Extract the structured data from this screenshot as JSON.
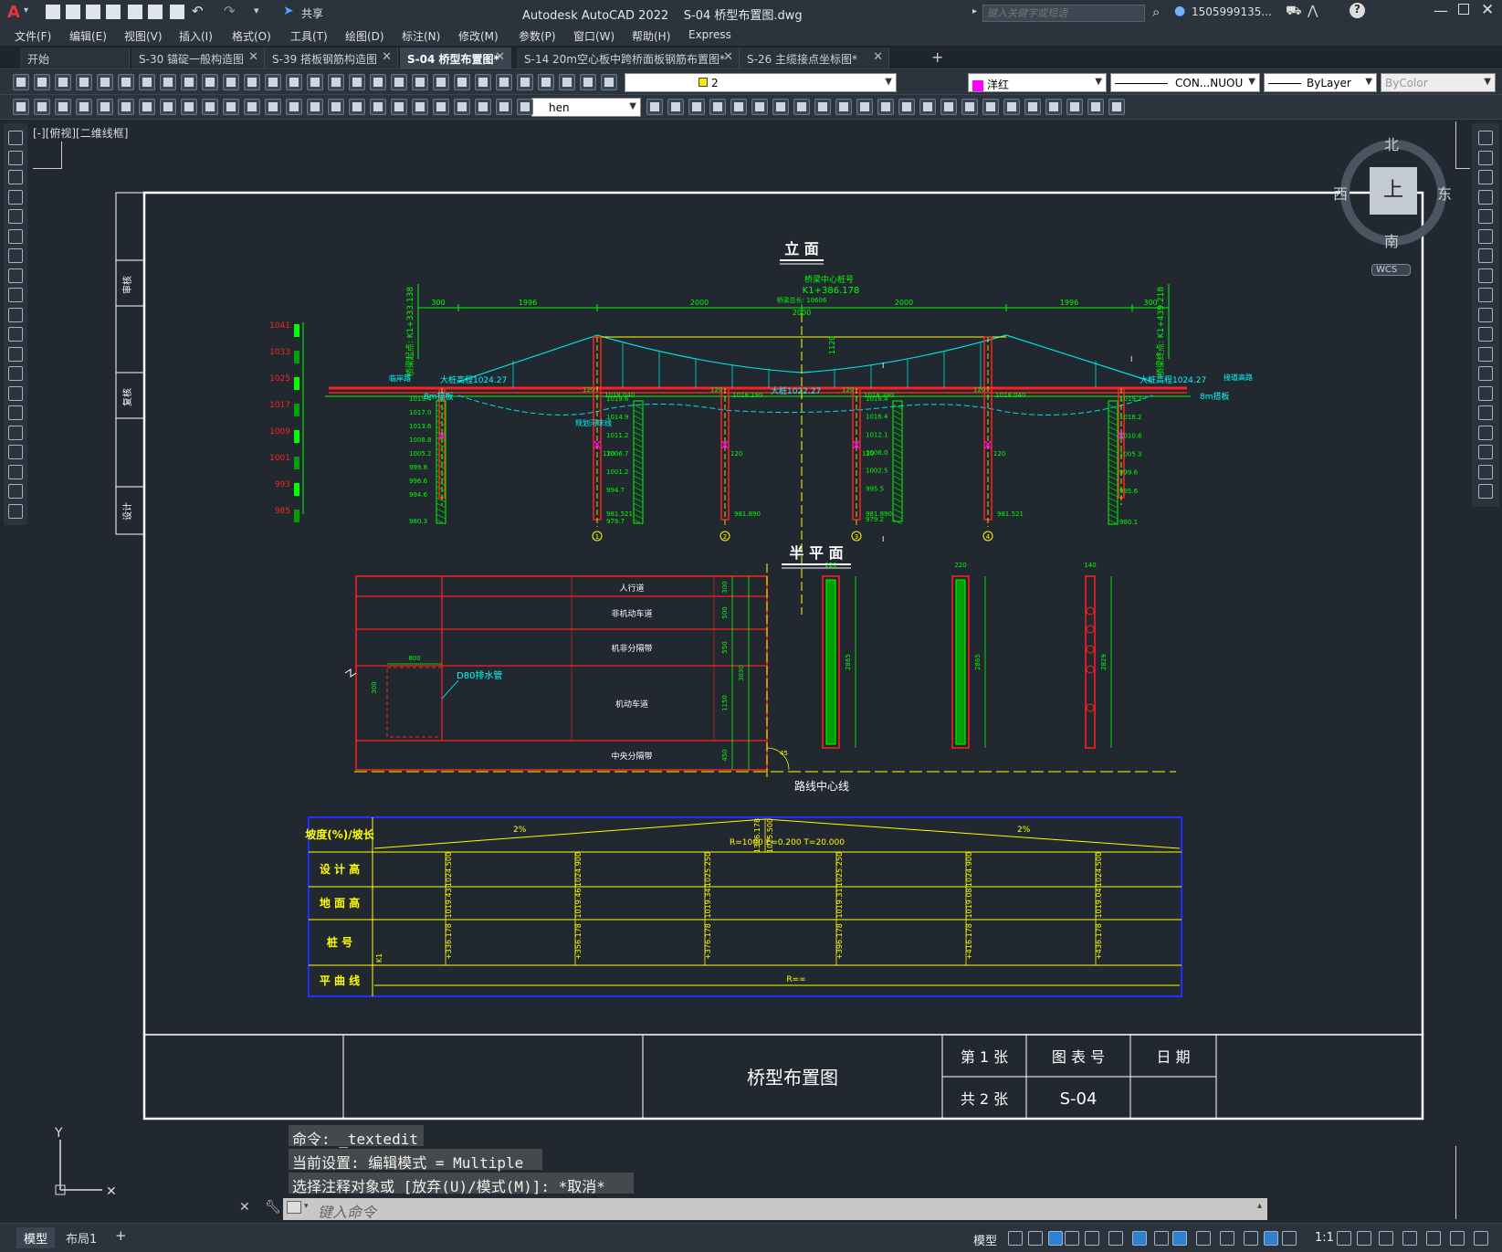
{
  "app": {
    "title": "Autodesk AutoCAD 2022    S-04 桥型布置图.dwg",
    "share_label": "共享",
    "search_placeholder": "键入关键字或短语",
    "user": "1505999135...",
    "logo_letter": "A"
  },
  "menu": [
    "文件(F)",
    "编辑(E)",
    "视图(V)",
    "插入(I)",
    "格式(O)",
    "工具(T)",
    "绘图(D)",
    "标注(N)",
    "修改(M)",
    "参数(P)",
    "窗口(W)",
    "帮助(H)",
    "Express"
  ],
  "tabs": [
    {
      "label": "开始",
      "active": false
    },
    {
      "label": "S-30 锚碇一般构造图",
      "active": false
    },
    {
      "label": "S-39 搭板钢筋构造图",
      "active": false
    },
    {
      "label": "S-04 桥型布置图*",
      "active": true
    },
    {
      "label": "S-14 20m空心板中跨桥面板钢筋布置图*",
      "active": false
    },
    {
      "label": "S-26 主缆接点坐标图*",
      "active": false
    }
  ],
  "toolbar": {
    "layer_value": "2",
    "color_value": "洋红",
    "linetype_value": "CON...NUOU",
    "lineweight_value": "ByLayer",
    "plotstyle_value": "ByColor",
    "textstyle_value": "hen"
  },
  "viewport_label": "[-][俯视][二维线框]",
  "viewcube": {
    "north": "北",
    "south": "南",
    "east": "东",
    "west": "西",
    "top": "上",
    "wcs": "WCS"
  },
  "drawing": {
    "elevation_title": "立  面",
    "plan_title": "半  平  面",
    "bridge_center": "桥梁中心桩号",
    "bridge_center_station": "K1+386.178",
    "total_length": "桥梁总长: 10606",
    "start_station": "桥梁起点: K1+333.138",
    "end_station": "桥梁终点: K1+439.218",
    "dims_top": [
      "300",
      "1996",
      "2000",
      "2000",
      "2000",
      "1996",
      "300"
    ],
    "left_scale": [
      "1041",
      "1033",
      "1025",
      "1017",
      "1009",
      "1001",
      "993",
      "985"
    ],
    "left_abut_label": "大桩高程1024.27",
    "right_abut_label": "大桩高程1024.27",
    "mid_label": "大桩1022.27",
    "left_road": "8m搭板",
    "right_road": "8m搭板",
    "left_note": "临岸路",
    "right_note": "接道高路",
    "river_label": "规划河床线",
    "pier_ids": [
      "1",
      "2",
      "3",
      "4"
    ],
    "section_mark": "I",
    "elev_values_left": [
      "1019.4",
      "1017.0",
      "1013.6",
      "1008.8",
      "1005.2",
      "999.8",
      "996.6",
      "994.6",
      "980.3"
    ],
    "elev_values_p1": [
      "1018.040",
      "981.521"
    ],
    "elev_values_b1": [
      "1019.6",
      "1014.9",
      "1011.2",
      "1006.7",
      "1001.2",
      "994.7",
      "979.7"
    ],
    "elev_values_p2": [
      "1018.190",
      "981.890"
    ],
    "elev_values_p3": [
      "1018.390",
      "981.890"
    ],
    "elev_values_b2": [
      "1018.4",
      "1016.4",
      "1012.1",
      "1006.0",
      "1002.5",
      "995.5",
      "979.2"
    ],
    "elev_values_p4": [
      "1018.040",
      "981.521"
    ],
    "elev_values_right": [
      "1019.3",
      "1016.2",
      "1010.6",
      "1005.3",
      "999.6",
      "995.6",
      "980.1"
    ],
    "dim_120": "120",
    "dim_1120": "1120",
    "plan_rows": [
      "人行道",
      "非机动车道",
      "机非分隔带",
      "机动车道",
      "中央分隔带"
    ],
    "plan_dims": [
      "300",
      "500",
      "550",
      "1150",
      "450",
      "3030"
    ],
    "plan_800": "800",
    "plan_300": "300",
    "drain_label": "D80排水管",
    "centerline_label": "路线中心线",
    "plan_45": "45",
    "pier_widths": [
      "220",
      "220",
      "140"
    ],
    "pier_heights": [
      "2865",
      "2865",
      "2829"
    ]
  },
  "profile_table": {
    "rows": [
      "坡度(%)/坡长",
      "设  计  高",
      "地  面  高",
      "桩        号",
      "平  曲  线"
    ],
    "slope_left": "2%",
    "slope_right": "2%",
    "curve": "R=1000     E=0.200   T=20.000",
    "vpi_station": "1386.178",
    "vpi_elev": "1025.500",
    "design_heights": [
      "1024.500",
      "1024.900",
      "1025.250",
      "1025.250",
      "1024.900",
      "1024.500"
    ],
    "ground_heights": [
      "1019.43",
      "1019.46",
      "1019.34",
      "1019.31",
      "1019.08",
      "1019.04"
    ],
    "stations": [
      "+336.178",
      "+356.178",
      "+376.178",
      "+396.178",
      "+416.178",
      "+436.178"
    ],
    "station_prefix": "K1",
    "plan_curve": "R=∞"
  },
  "title_block": {
    "name": "桥型布置图",
    "sheet_label": "第 1 张",
    "total_label": "共 2 张",
    "drawing_no_label": "图 表 号",
    "drawing_no": "S-04",
    "date_label": "日 期",
    "side_labels": [
      "审核",
      "复核",
      "设计"
    ]
  },
  "command": {
    "history": [
      "命令:  _textedit",
      "当前设置: 编辑模式 = Multiple",
      "选择注释对象或 [放弃(U)/模式(M)]: *取消*"
    ],
    "placeholder": "键入命令"
  },
  "status": {
    "layouts": [
      "模型",
      "布局1"
    ],
    "model_label": "模型",
    "scale": "1:1"
  },
  "colors": {
    "bg": "#212830",
    "green": "#00ff00",
    "red": "#ff2020",
    "cyan": "#00ffff",
    "yellow": "#ffff00",
    "blue": "#2030ff",
    "white": "#ffffff"
  }
}
